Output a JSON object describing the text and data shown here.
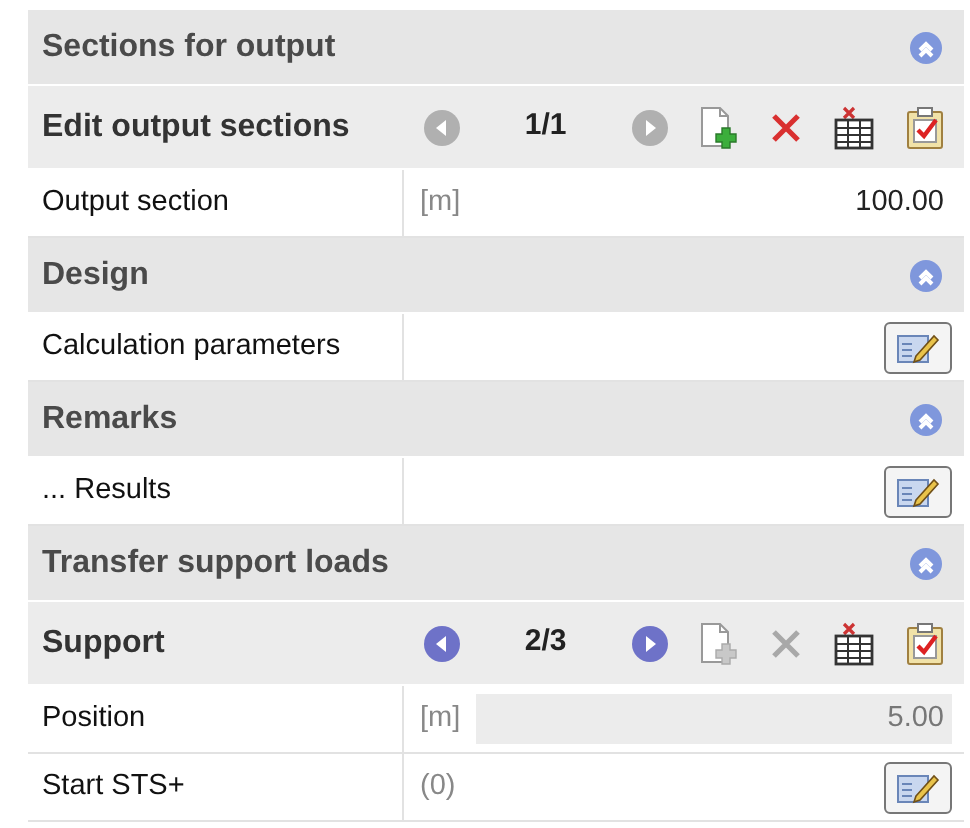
{
  "sections": [
    {
      "title": "Sections for output",
      "expanded": true,
      "rows": [
        {
          "kind": "nav",
          "label": "Edit output sections",
          "counter": "1/1",
          "prev_enabled": false,
          "next_enabled": false,
          "add_enabled": true,
          "delete_enabled": true
        },
        {
          "kind": "field",
          "label": "Output section",
          "unit": "[m]",
          "value": "100.00",
          "disabled": false
        }
      ]
    },
    {
      "title": "Design",
      "expanded": true,
      "rows": [
        {
          "kind": "button",
          "label": "Calculation parameters"
        }
      ]
    },
    {
      "title": "Remarks",
      "expanded": true,
      "rows": [
        {
          "kind": "button",
          "label": "... Results"
        }
      ]
    },
    {
      "title": "Transfer support loads",
      "expanded": true,
      "rows": [
        {
          "kind": "nav",
          "label": "Support",
          "counter": "2/3",
          "prev_enabled": true,
          "next_enabled": true,
          "add_enabled": false,
          "delete_enabled": false
        },
        {
          "kind": "field",
          "label": "Position",
          "unit": "[m]",
          "value": "5.00",
          "disabled": true
        },
        {
          "kind": "button",
          "label": "Start STS+",
          "note": "(0)"
        }
      ]
    }
  ]
}
